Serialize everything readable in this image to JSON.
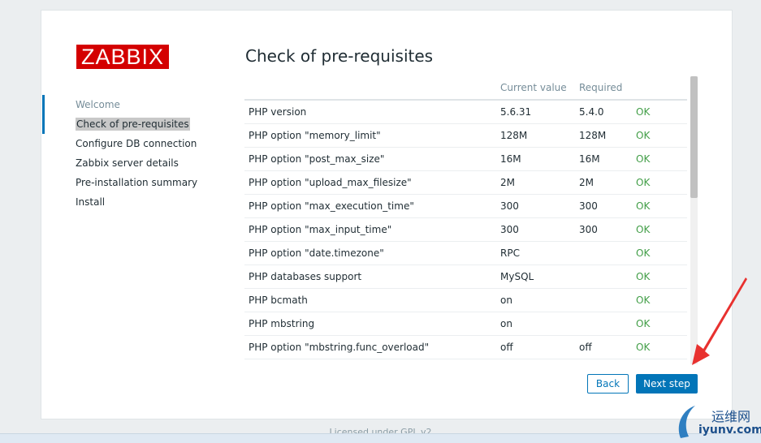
{
  "logo": {
    "text": "ZABBIX"
  },
  "steps": [
    {
      "label": "Welcome",
      "state": "done"
    },
    {
      "label": "Check of pre-requisites",
      "state": "current"
    },
    {
      "label": "Configure DB connection",
      "state": "todo"
    },
    {
      "label": "Zabbix server details",
      "state": "todo"
    },
    {
      "label": "Pre-installation summary",
      "state": "todo"
    },
    {
      "label": "Install",
      "state": "todo"
    }
  ],
  "main": {
    "title": "Check of pre-requisites",
    "table": {
      "headers": [
        "",
        "Current value",
        "Required",
        ""
      ],
      "rows": [
        [
          "PHP version",
          "5.6.31",
          "5.4.0",
          "OK"
        ],
        [
          "PHP option \"memory_limit\"",
          "128M",
          "128M",
          "OK"
        ],
        [
          "PHP option \"post_max_size\"",
          "16M",
          "16M",
          "OK"
        ],
        [
          "PHP option \"upload_max_filesize\"",
          "2M",
          "2M",
          "OK"
        ],
        [
          "PHP option \"max_execution_time\"",
          "300",
          "300",
          "OK"
        ],
        [
          "PHP option \"max_input_time\"",
          "300",
          "300",
          "OK"
        ],
        [
          "PHP option \"date.timezone\"",
          "RPC",
          "",
          "OK"
        ],
        [
          "PHP databases support",
          "MySQL",
          "",
          "OK"
        ],
        [
          "PHP bcmath",
          "on",
          "",
          "OK"
        ],
        [
          "PHP mbstring",
          "on",
          "",
          "OK"
        ],
        [
          "PHP option \"mbstring.func_overload\"",
          "off",
          "off",
          "OK"
        ]
      ]
    }
  },
  "buttons": {
    "back": "Back",
    "next": "Next step"
  },
  "footer": {
    "text": "Licensed under GPL v2"
  },
  "watermark": {
    "line1": "运维网",
    "line2": "iyunv.com"
  },
  "colors": {
    "brand_red": "#d40000",
    "accent_blue": "#0275b8",
    "ok_green": "#429e47",
    "annotation_red": "#e8312f"
  }
}
